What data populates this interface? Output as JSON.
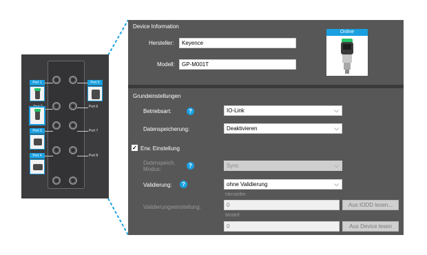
{
  "ports": {
    "port1": "Port 1",
    "port2": "Port 2",
    "port3": "Port 3",
    "port4": "Port 4",
    "port5": "Port 5",
    "port6": "Port 6",
    "port7": "Port 7",
    "port8": "Port 8"
  },
  "device_info": {
    "title": "Device Information",
    "hersteller_label": "Hersteller:",
    "hersteller_value": "Keyence",
    "modell_label": "Modell:",
    "modell_value": "GP-M001T",
    "status_badge": "Online"
  },
  "grundeinstellungen": {
    "title": "Grundeinstellungen",
    "betriebsart_label": "Betriebsart:",
    "betriebsart_value": "IO-Link",
    "datenspeicherung_label": "Datenspeicherung:",
    "datenspeicherung_value": "Deaktivieren"
  },
  "erweitert": {
    "checkbox_label": "Erw. Einstellung",
    "checked": true,
    "datenspeich_label_line1": "Datenspeich.",
    "datenspeich_label_line2": "Modus:",
    "datenspeich_value": "Sync",
    "validierung_label": "Validierung:",
    "validierung_value": "ohne Validierung",
    "validierungseinstellung_label": "Validierungseinstellung:",
    "hersteller_hint": "Hersteller",
    "hersteller_field": "0",
    "iodd_button": "Aus IODD lesen...",
    "modell_hint": "Modell",
    "modell_field": "0",
    "device_button": "Aus Device lesen"
  },
  "colors": {
    "accent": "#1aa0e0",
    "panel": "#575757",
    "online_status": "#27c46a"
  }
}
